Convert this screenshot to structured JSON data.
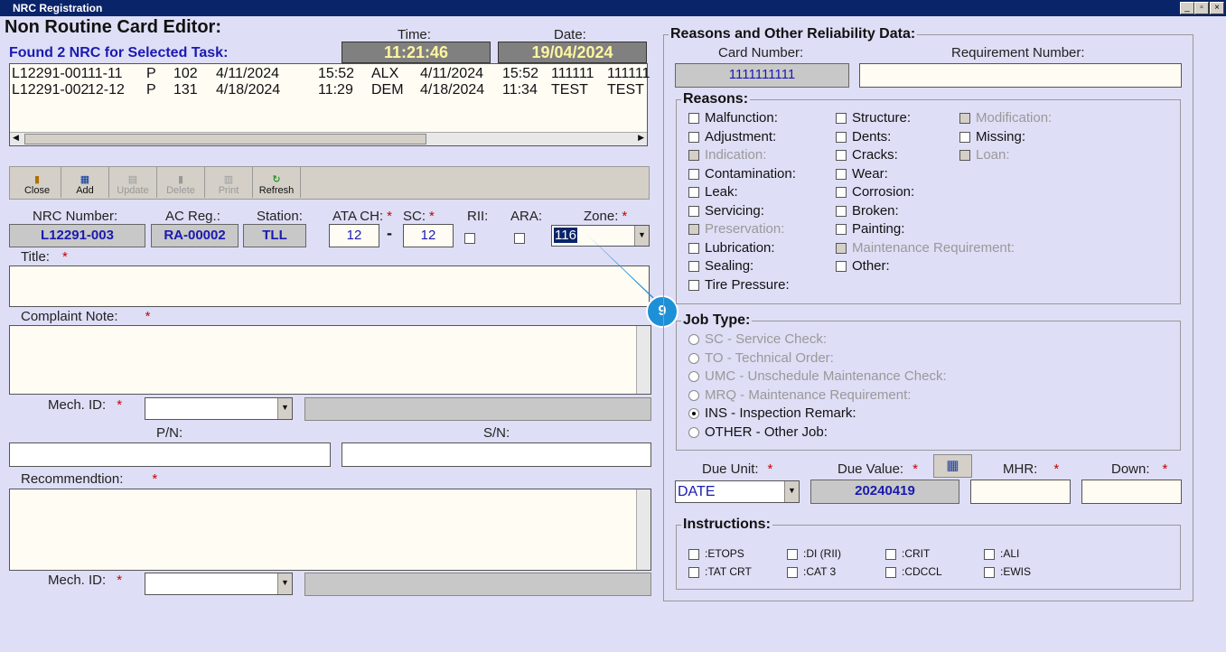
{
  "window": {
    "title": "NRC Registration"
  },
  "editor": {
    "title": "Non Routine Card Editor:",
    "time_label": "Time:",
    "time": "11:21:46",
    "date_label": "Date:",
    "date": "19/04/2024",
    "found": "Found 2 NRC for Selected Task:",
    "rows": [
      [
        "L12291-001",
        "11-11",
        "P",
        "102",
        "4/11/2024",
        "15:52",
        "ALX",
        "4/11/2024",
        "15:52",
        "111111",
        "111111"
      ],
      [
        "L12291-002",
        "12-12",
        "P",
        "131",
        "4/18/2024",
        "11:29",
        "DEM",
        "4/18/2024",
        "11:34",
        "TEST",
        "TEST"
      ]
    ]
  },
  "toolbar": {
    "close": "Close",
    "add": "Add",
    "update": "Update",
    "delete": "Delete",
    "print": "Print",
    "refresh": "Refresh"
  },
  "form": {
    "nrc_label": "NRC Number:",
    "nrc": "L12291-003",
    "acreg_label": "AC Reg.:",
    "acreg": "RA-00002",
    "station_label": "Station:",
    "station": "TLL",
    "ata_label": "ATA CH:",
    "ata": "12",
    "sc_label": "SC:",
    "sc": "12",
    "rii_label": "RII:",
    "ara_label": "ARA:",
    "zone_label": "Zone:",
    "zone": "116",
    "title_label": "Title:",
    "complaint_label": "Complaint Note:",
    "mech_label": "Mech. ID:",
    "pn_label": "P/N:",
    "sn_label": "S/N:",
    "recommendation_label": "Recommendtion:",
    "required": "*",
    "dash": "-"
  },
  "callout": {
    "number": "9"
  },
  "reasons_panel": {
    "title": "Reasons and Other Reliability Data:",
    "card_label": "Card Number:",
    "card": "1111111111",
    "req_label": "Requirement Number:",
    "reasons_title": "Reasons:",
    "col1": [
      {
        "label": "Malfunction:",
        "enabled": true
      },
      {
        "label": "Adjustment:",
        "enabled": true
      },
      {
        "label": "Indication:",
        "enabled": false
      },
      {
        "label": "Contamination:",
        "enabled": true
      },
      {
        "label": "Leak:",
        "enabled": true
      },
      {
        "label": "Servicing:",
        "enabled": true
      },
      {
        "label": "Preservation:",
        "enabled": false
      },
      {
        "label": "Lubrication:",
        "enabled": true
      },
      {
        "label": "Sealing:",
        "enabled": true
      },
      {
        "label": "Tire Pressure:",
        "enabled": true
      }
    ],
    "col2": [
      {
        "label": "Structure:",
        "enabled": true
      },
      {
        "label": "Dents:",
        "enabled": true
      },
      {
        "label": "Cracks:",
        "enabled": true
      },
      {
        "label": "Wear:",
        "enabled": true
      },
      {
        "label": "Corrosion:",
        "enabled": true
      },
      {
        "label": "Broken:",
        "enabled": true
      },
      {
        "label": "Painting:",
        "enabled": true
      },
      {
        "label": "Maintenance Requirement:",
        "enabled": false
      },
      {
        "label": "Other:",
        "enabled": true
      }
    ],
    "col3": [
      {
        "label": "Modification:",
        "enabled": false
      },
      {
        "label": "Missing:",
        "enabled": true
      },
      {
        "label": "Loan:",
        "enabled": false
      }
    ],
    "job_title": "Job Type:",
    "jobs": [
      {
        "label": "SC - Service Check:",
        "enabled": false,
        "selected": false
      },
      {
        "label": "TO - Technical Order:",
        "enabled": false,
        "selected": false
      },
      {
        "label": "UMC - Unschedule Maintenance Check:",
        "enabled": false,
        "selected": false
      },
      {
        "label": "MRQ - Maintenance Requirement:",
        "enabled": false,
        "selected": false
      },
      {
        "label": "INS - Inspection Remark:",
        "enabled": true,
        "selected": true
      },
      {
        "label": "OTHER - Other Job:",
        "enabled": true,
        "selected": false
      }
    ],
    "due_unit_label": "Due Unit:",
    "due_unit": "DATE",
    "due_value_label": "Due Value:",
    "due_value": "20240419",
    "mhr_label": "MHR:",
    "down_label": "Down:",
    "instructions_title": "Instructions:",
    "instructions": [
      ":ETOPS",
      ":DI (RII)",
      ":CRIT",
      ":ALI",
      ":TAT CRT",
      ":CAT 3",
      ":CDCCL",
      ":EWIS"
    ]
  }
}
